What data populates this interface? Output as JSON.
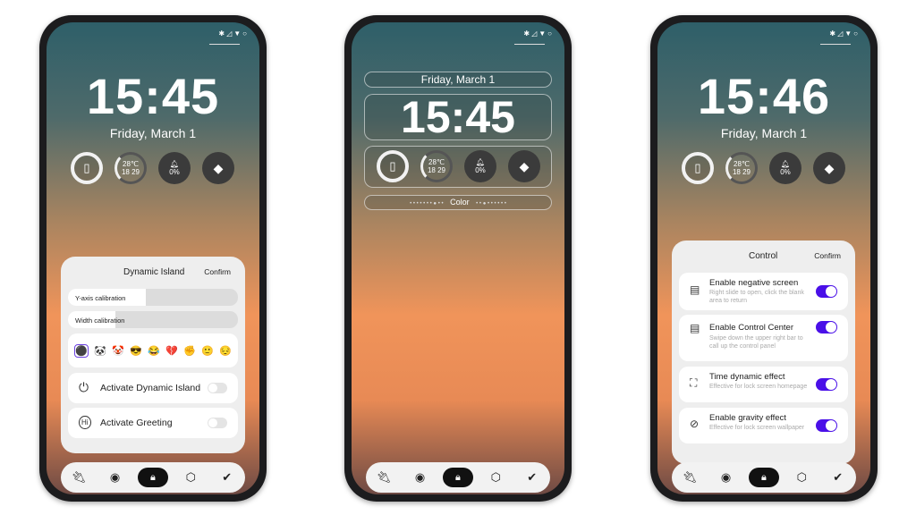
{
  "status_icons": "✱◿▼○",
  "phones": [
    {
      "time": "15:45",
      "date": "Friday, March 1",
      "temp": "28℃",
      "temp_range": "18 29",
      "dnd": "0%",
      "panel": {
        "title": "Dynamic Island",
        "confirm": "Confirm",
        "sliders": [
          {
            "label": "Y-axis calibration",
            "icon": "⬍",
            "value": 0.5
          },
          {
            "label": "Width calibration",
            "icon": "⬌",
            "value": 0.28
          }
        ],
        "emojis": [
          "⚫",
          "🐼",
          "🤡",
          "😎",
          "😂",
          "💔",
          "✊",
          "🙂",
          "😔"
        ],
        "toggles": [
          {
            "label": "Activate Dynamic Island",
            "icon": "power-icon",
            "on": false
          },
          {
            "label": "Activate Greeting",
            "icon": "hi-bubble-icon",
            "on": false
          }
        ]
      }
    },
    {
      "time": "15:45",
      "date": "Friday, March 1",
      "temp": "28℃",
      "temp_range": "18 29",
      "dnd": "0%",
      "color_label": "Color"
    },
    {
      "time": "15:46",
      "date": "Friday, March 1",
      "temp": "28℃",
      "temp_range": "18 29",
      "dnd": "0%",
      "panel": {
        "title": "Control",
        "confirm": "Confirm",
        "items": [
          {
            "title": "Enable negative screen",
            "sub": "Right slide to open, click the blank area to return",
            "on": true
          },
          {
            "title": "Enable Control Center",
            "sub": "Swipe down the upper right bar to call up the control panel",
            "on": true
          },
          {
            "title": "Time dynamic effect",
            "sub": "Effective for lock screen homepage",
            "on": true
          },
          {
            "title": "Enable gravity effect",
            "sub": "Effective for lock screen wallpaper",
            "on": true
          }
        ]
      }
    }
  ],
  "nav": [
    "plug-icon",
    "toggle-icon",
    "lock-icon",
    "hexagon-settings-icon",
    "check-icon"
  ],
  "accent": "#4a10e8"
}
